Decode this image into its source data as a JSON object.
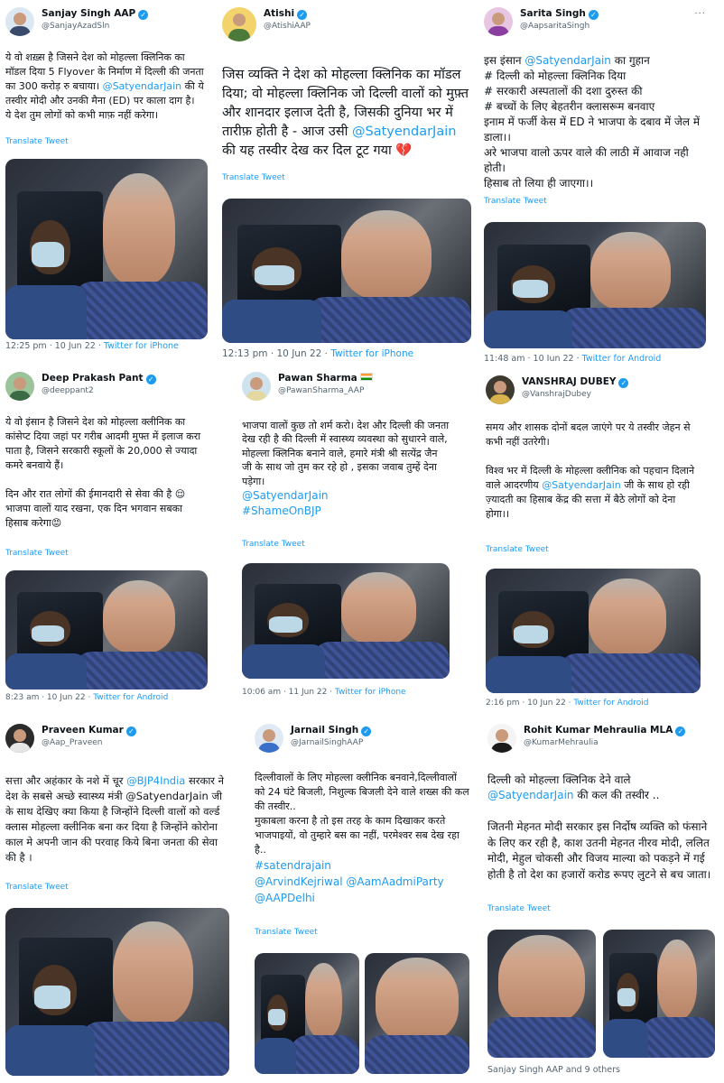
{
  "tweets": [
    {
      "name": "Sanjay Singh AAP",
      "handle": "@SanjayAzadSln",
      "text": "ये वो शख़्स है जिसने देश को मोहल्ला क्लिनिक का मॉडल दिया 5 Flyover के निर्माण में दिल्ली की जनता का 300 करोड़ रु बचाया।",
      "mention": "@SatyendarJain",
      "text_after": " की ये तस्वीर मोदी और उनकी मैना (ED) पर काला दाग है।\nये देश तुम लोगों को कभी माफ़ नहीं करेगा।",
      "translate": "Translate Tweet",
      "time": "12:25 pm · 10 Jun 22 · ",
      "source": "Twitter for iPhone"
    },
    {
      "name": "Atishi",
      "handle": "@AtishiAAP",
      "text": "जिस व्यक्ति ने देश को मोहल्ला क्लिनिक का मॉडल दिया; वो मोहल्ला क्लिनिक जो दिल्ली वालों को मुफ़्त और शानदार इलाज देती है, जिसकी दुनिया भर में तारीफ़ होती है - आज उसी ",
      "mention": "@SatyendarJain",
      "text_after": " की यह तस्वीर देख कर दिल टूट गया 💔",
      "translate": "Translate Tweet",
      "time": "12:13 pm · 10 Jun 22 · ",
      "source": "Twitter for iPhone"
    },
    {
      "name": "Sarita Singh",
      "handle": "@AapsaritaSingh",
      "text": "इस इंसान ",
      "mention": "@SatyendarJain",
      "text_after": " का गुहान\n# दिल्ली को मोहल्ला क्लिनिक दिया\n# सरकारी अस्पतालों की दशा दुरुस्त की\n# बच्चों के लिए बेहतरीन क्लासरूम बनवाए\nइनाम में फर्जी केस में ED ने भाजपा के दबाव में जेल में डाला।।\nअरे भाजपा वालो ऊपर वाले की लाठी में आवाज नही होती।\nहिसाब तो लिया ही जाएगा।।",
      "translate": "Translate Tweet",
      "time": "11:48 am · 10 Jun 22 · ",
      "source": "Twitter for Android"
    },
    {
      "name": "Deep Prakash Pant",
      "handle": "@deeppant2",
      "text": "ये वो इंसान है जिसने देश को मोहल्ला क्लीनिक का कांसेप्ट दिया जहां पर गरीब आदमी मुफ्त में इलाज करा पाता है, जिसने सरकारी स्कूलों के 20,000 से ज्यादा कमरे बनवाये हैं।\n\nदिन और रात लोगों की ईमानदारी से सेवा की है 😌\nभाजपा वालों याद रखना, एक दिन भगवान सबका हिसाब करेगा😡",
      "mention": "",
      "text_after": "",
      "translate": "Translate Tweet",
      "time": "8:23 am · 10 Jun 22 · ",
      "source": "Twitter for Android"
    },
    {
      "name": "Pawan Sharma",
      "handle": "@PawanSharma_AAP",
      "text": "भाजपा वालों कुछ तो शर्म करो। देश और दिल्ली की जनता देख रही है की दिल्ली में स्वास्थ्य व्यवस्था को सुधारने वाले, मोहल्ला क्लिनिक बनाने वाले, हमारे मंत्री श्री सत्येंद्र जैन जी के साथ जो तुम कर रहे हो , इसका जवाब तुम्हें देना पड़ेगा।",
      "mention": "@SatyendarJain\n#ShameOnBJP",
      "text_after": "",
      "translate": "Translate Tweet",
      "time": "10:06 am · 11 Jun 22 · ",
      "source": "Twitter for iPhone"
    },
    {
      "name": "VANSHRAJ DUBEY",
      "handle": "@VanshrajDubey",
      "text": "समय और शासक दोनों बदल जाएंगे पर ये तस्वीर जेहन से कभी नहीं उतरेगी।\n\nविश्व भर में दिल्ली के मोहल्ला क्लीनिक को पहचान दिलाने वाले आदरणीय ",
      "mention": "@SatyendarJain",
      "text_after": " जी के साथ हो रही ज़्यादती का हिसाब केंद्र की सत्ता में बैठे लोगों को देना होगा।।",
      "translate": "Translate Tweet",
      "time": "2:16 pm · 10 Jun 22 · ",
      "source": "Twitter for Android"
    },
    {
      "name": "Praveen Kumar",
      "handle": "@Aap_Praveen",
      "text": "सत्ता और अहंकार के नशे में चूर ",
      "mention": "@BJP4India",
      "text_after": " सरकार ने देश के सबसे अच्छे स्वास्थ्य मंत्री @SatyendarJain जी के साथ देखिए क्या किया है जिन्होंने दिल्ली वालों को वर्ल्ड क्लास मोहल्ला क्लीनिक बना कर दिया है जिन्होंने कोरोना काल मे अपनी जान की परवाह किये बिना जनता की सेवा की है ।",
      "translate": "Translate Tweet",
      "time": "",
      "source": ""
    },
    {
      "name": "Jarnail Singh",
      "handle": "@JarnailSinghAAP",
      "text": "दिल्लीवालों के लिए मोहल्ला क्लीनिक बनवाने,दिल्लीवालों को 24 घंटे बिजली, निशुल्क बिजली देने वाले शख्स की कल की तस्वीर..\nमुकाबला करना है तो इस तरह के काम दिखाकर करते भाजपाइयों, वो तुम्हारे बस का नहीं, परमेश्वर सब देख रहा है..",
      "mention": "#satendrajain\n@ArvindKejriwal @AamAadmiParty\n@AAPDelhi",
      "text_after": "",
      "translate": "Translate Tweet",
      "time": "",
      "source": ""
    },
    {
      "name": "Rohit Kumar Mehraulia MLA",
      "handle": "@KumarMehraulia",
      "text": "दिल्ली को मोहल्ला क्लिनिक देने वाले ",
      "mention": "@SatyendarJain",
      "text_after": " की कल की तस्वीर ..\n\nजितनी मेहनत मोदी सरकार इस निर्दोष व्यक्ति को  फंसाने के लिए कर रही है, काश उतनी मेहनत नीरव मोदी, ललित मोदी, मेहुल चोकसी और विजय माल्या को पकड़ने में गई होती है तो देश का हजारों करोड रूपए लुटने से बच जाता।",
      "translate": "Translate Tweet",
      "time": "",
      "source": ""
    }
  ],
  "footer_note": "Sanjay Singh AAP and 9 others"
}
